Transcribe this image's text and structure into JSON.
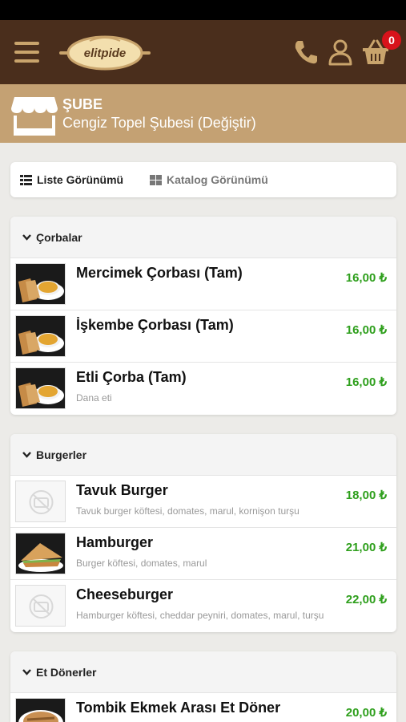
{
  "header": {
    "logo_text": "elitpide",
    "cart_count": "0",
    "colors": {
      "bar": "#4a2e1c",
      "accent": "#c9a46c",
      "badge": "#d8131b"
    },
    "icons": [
      "menu-icon",
      "phone-icon",
      "user-icon",
      "cart-icon"
    ]
  },
  "branch": {
    "title": "ŞUBE",
    "name": "Cengiz Topel Şubesi (Değiştir)"
  },
  "view_toggle": {
    "list_label": "Liste Görünümü",
    "catalog_label": "Katalog Görünümü",
    "active": "list"
  },
  "sections": [
    {
      "title": "Çorbalar",
      "items": [
        {
          "name": "Mercimek Çorbası (Tam)",
          "desc": "",
          "price": "16,00 ₺",
          "image": "soup"
        },
        {
          "name": "İşkembe Çorbası (Tam)",
          "desc": "",
          "price": "16,00 ₺",
          "image": "soup"
        },
        {
          "name": "Etli Çorba (Tam)",
          "desc": "Dana eti",
          "price": "16,00 ₺",
          "image": "soup"
        }
      ]
    },
    {
      "title": "Burgerler",
      "items": [
        {
          "name": "Tavuk Burger",
          "desc": "Tavuk burger köftesi, domates, marul, kornişon turşu",
          "price": "18,00 ₺",
          "image": "placeholder"
        },
        {
          "name": "Hamburger",
          "desc": "Burger köftesi, domates, marul",
          "price": "21,00 ₺",
          "image": "sandwich"
        },
        {
          "name": "Cheeseburger",
          "desc": "Hamburger köftesi, cheddar peyniri, domates, marul, turşu",
          "price": "22,00 ₺",
          "image": "placeholder"
        }
      ]
    },
    {
      "title": "Et Dönerler",
      "items": [
        {
          "name": "Tombik Ekmek Arası Et Döner",
          "desc": "",
          "price": "20,00 ₺",
          "image": "sandwich"
        }
      ]
    }
  ]
}
